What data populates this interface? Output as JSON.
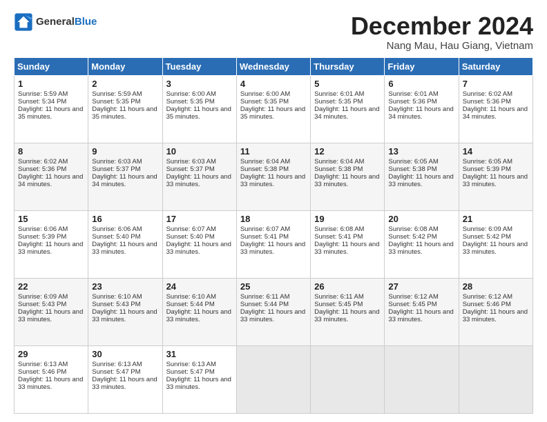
{
  "logo": {
    "general": "General",
    "blue": "Blue"
  },
  "header": {
    "month": "December 2024",
    "location": "Nang Mau, Hau Giang, Vietnam"
  },
  "weekdays": [
    "Sunday",
    "Monday",
    "Tuesday",
    "Wednesday",
    "Thursday",
    "Friday",
    "Saturday"
  ],
  "weeks": [
    [
      {
        "day": "1",
        "sunrise": "Sunrise: 5:59 AM",
        "sunset": "Sunset: 5:34 PM",
        "daylight": "Daylight: 11 hours and 35 minutes."
      },
      {
        "day": "2",
        "sunrise": "Sunrise: 5:59 AM",
        "sunset": "Sunset: 5:35 PM",
        "daylight": "Daylight: 11 hours and 35 minutes."
      },
      {
        "day": "3",
        "sunrise": "Sunrise: 6:00 AM",
        "sunset": "Sunset: 5:35 PM",
        "daylight": "Daylight: 11 hours and 35 minutes."
      },
      {
        "day": "4",
        "sunrise": "Sunrise: 6:00 AM",
        "sunset": "Sunset: 5:35 PM",
        "daylight": "Daylight: 11 hours and 35 minutes."
      },
      {
        "day": "5",
        "sunrise": "Sunrise: 6:01 AM",
        "sunset": "Sunset: 5:35 PM",
        "daylight": "Daylight: 11 hours and 34 minutes."
      },
      {
        "day": "6",
        "sunrise": "Sunrise: 6:01 AM",
        "sunset": "Sunset: 5:36 PM",
        "daylight": "Daylight: 11 hours and 34 minutes."
      },
      {
        "day": "7",
        "sunrise": "Sunrise: 6:02 AM",
        "sunset": "Sunset: 5:36 PM",
        "daylight": "Daylight: 11 hours and 34 minutes."
      }
    ],
    [
      {
        "day": "8",
        "sunrise": "Sunrise: 6:02 AM",
        "sunset": "Sunset: 5:36 PM",
        "daylight": "Daylight: 11 hours and 34 minutes."
      },
      {
        "day": "9",
        "sunrise": "Sunrise: 6:03 AM",
        "sunset": "Sunset: 5:37 PM",
        "daylight": "Daylight: 11 hours and 34 minutes."
      },
      {
        "day": "10",
        "sunrise": "Sunrise: 6:03 AM",
        "sunset": "Sunset: 5:37 PM",
        "daylight": "Daylight: 11 hours and 33 minutes."
      },
      {
        "day": "11",
        "sunrise": "Sunrise: 6:04 AM",
        "sunset": "Sunset: 5:38 PM",
        "daylight": "Daylight: 11 hours and 33 minutes."
      },
      {
        "day": "12",
        "sunrise": "Sunrise: 6:04 AM",
        "sunset": "Sunset: 5:38 PM",
        "daylight": "Daylight: 11 hours and 33 minutes."
      },
      {
        "day": "13",
        "sunrise": "Sunrise: 6:05 AM",
        "sunset": "Sunset: 5:38 PM",
        "daylight": "Daylight: 11 hours and 33 minutes."
      },
      {
        "day": "14",
        "sunrise": "Sunrise: 6:05 AM",
        "sunset": "Sunset: 5:39 PM",
        "daylight": "Daylight: 11 hours and 33 minutes."
      }
    ],
    [
      {
        "day": "15",
        "sunrise": "Sunrise: 6:06 AM",
        "sunset": "Sunset: 5:39 PM",
        "daylight": "Daylight: 11 hours and 33 minutes."
      },
      {
        "day": "16",
        "sunrise": "Sunrise: 6:06 AM",
        "sunset": "Sunset: 5:40 PM",
        "daylight": "Daylight: 11 hours and 33 minutes."
      },
      {
        "day": "17",
        "sunrise": "Sunrise: 6:07 AM",
        "sunset": "Sunset: 5:40 PM",
        "daylight": "Daylight: 11 hours and 33 minutes."
      },
      {
        "day": "18",
        "sunrise": "Sunrise: 6:07 AM",
        "sunset": "Sunset: 5:41 PM",
        "daylight": "Daylight: 11 hours and 33 minutes."
      },
      {
        "day": "19",
        "sunrise": "Sunrise: 6:08 AM",
        "sunset": "Sunset: 5:41 PM",
        "daylight": "Daylight: 11 hours and 33 minutes."
      },
      {
        "day": "20",
        "sunrise": "Sunrise: 6:08 AM",
        "sunset": "Sunset: 5:42 PM",
        "daylight": "Daylight: 11 hours and 33 minutes."
      },
      {
        "day": "21",
        "sunrise": "Sunrise: 6:09 AM",
        "sunset": "Sunset: 5:42 PM",
        "daylight": "Daylight: 11 hours and 33 minutes."
      }
    ],
    [
      {
        "day": "22",
        "sunrise": "Sunrise: 6:09 AM",
        "sunset": "Sunset: 5:43 PM",
        "daylight": "Daylight: 11 hours and 33 minutes."
      },
      {
        "day": "23",
        "sunrise": "Sunrise: 6:10 AM",
        "sunset": "Sunset: 5:43 PM",
        "daylight": "Daylight: 11 hours and 33 minutes."
      },
      {
        "day": "24",
        "sunrise": "Sunrise: 6:10 AM",
        "sunset": "Sunset: 5:44 PM",
        "daylight": "Daylight: 11 hours and 33 minutes."
      },
      {
        "day": "25",
        "sunrise": "Sunrise: 6:11 AM",
        "sunset": "Sunset: 5:44 PM",
        "daylight": "Daylight: 11 hours and 33 minutes."
      },
      {
        "day": "26",
        "sunrise": "Sunrise: 6:11 AM",
        "sunset": "Sunset: 5:45 PM",
        "daylight": "Daylight: 11 hours and 33 minutes."
      },
      {
        "day": "27",
        "sunrise": "Sunrise: 6:12 AM",
        "sunset": "Sunset: 5:45 PM",
        "daylight": "Daylight: 11 hours and 33 minutes."
      },
      {
        "day": "28",
        "sunrise": "Sunrise: 6:12 AM",
        "sunset": "Sunset: 5:46 PM",
        "daylight": "Daylight: 11 hours and 33 minutes."
      }
    ],
    [
      {
        "day": "29",
        "sunrise": "Sunrise: 6:13 AM",
        "sunset": "Sunset: 5:46 PM",
        "daylight": "Daylight: 11 hours and 33 minutes."
      },
      {
        "day": "30",
        "sunrise": "Sunrise: 6:13 AM",
        "sunset": "Sunset: 5:47 PM",
        "daylight": "Daylight: 11 hours and 33 minutes."
      },
      {
        "day": "31",
        "sunrise": "Sunrise: 6:13 AM",
        "sunset": "Sunset: 5:47 PM",
        "daylight": "Daylight: 11 hours and 33 minutes."
      },
      null,
      null,
      null,
      null
    ]
  ]
}
